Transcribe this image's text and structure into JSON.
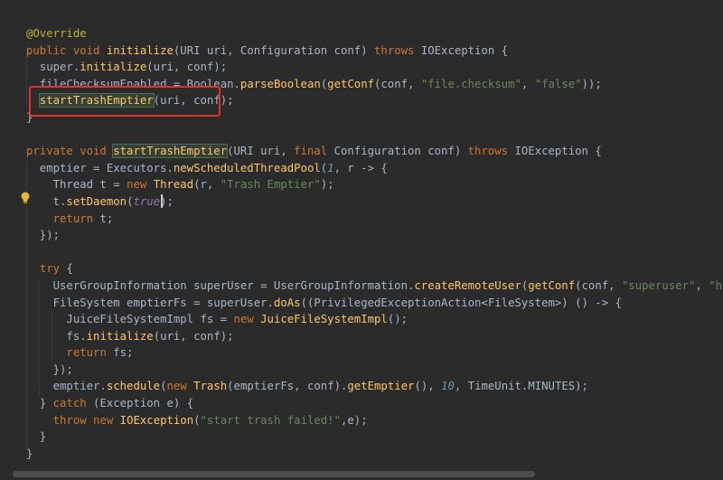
{
  "editor": {
    "lines": [
      [
        {
          "t": "@Override",
          "c": "ann"
        }
      ],
      [
        {
          "t": "public void ",
          "c": "kw"
        },
        {
          "t": "initialize",
          "c": "fn"
        },
        {
          "t": "(URI uri, Configuration conf) ",
          "c": "pl"
        },
        {
          "t": "throws ",
          "c": "kw"
        },
        {
          "t": "IOException {",
          "c": "pl"
        }
      ],
      [
        {
          "t": "  super.",
          "c": "pl"
        },
        {
          "t": "initialize",
          "c": "fn"
        },
        {
          "t": "(uri, conf);",
          "c": "pl"
        }
      ],
      [
        {
          "t": "  fileChecksumEnabled = Boolean.",
          "c": "pl"
        },
        {
          "t": "parseBoolean",
          "c": "fn"
        },
        {
          "t": "(",
          "c": "pl"
        },
        {
          "t": "getConf",
          "c": "fn"
        },
        {
          "t": "(conf, ",
          "c": "pl"
        },
        {
          "t": "\"file.checksum\"",
          "c": "str"
        },
        {
          "t": ", ",
          "c": "pl"
        },
        {
          "t": "\"false\"",
          "c": "str"
        },
        {
          "t": "));",
          "c": "pl"
        }
      ],
      [
        {
          "t": "  ",
          "c": "pl"
        },
        {
          "t": "startTrashEmptier",
          "c": "fn",
          "hl": true
        },
        {
          "t": "(uri, conf);",
          "c": "pl"
        }
      ],
      [
        {
          "t": "}",
          "c": "pl"
        }
      ],
      [],
      [
        {
          "t": "private void ",
          "c": "kw"
        },
        {
          "t": "startTrashEmptier",
          "c": "fn",
          "hl": true
        },
        {
          "t": "(URI uri, ",
          "c": "pl"
        },
        {
          "t": "final ",
          "c": "kw"
        },
        {
          "t": "Configuration conf) ",
          "c": "pl"
        },
        {
          "t": "throws ",
          "c": "kw"
        },
        {
          "t": "IOException {",
          "c": "pl"
        }
      ],
      [
        {
          "t": "  emptier = Executors.",
          "c": "pl"
        },
        {
          "t": "newScheduledThreadPool",
          "c": "fn"
        },
        {
          "t": "(",
          "c": "pl"
        },
        {
          "t": "1",
          "c": "num"
        },
        {
          "t": ", r -> {",
          "c": "pl"
        }
      ],
      [
        {
          "t": "    Thread t = ",
          "c": "pl"
        },
        {
          "t": "new ",
          "c": "kw"
        },
        {
          "t": "Thread",
          "c": "fn"
        },
        {
          "t": "(r, ",
          "c": "pl"
        },
        {
          "t": "\"Trash Emptier\"",
          "c": "str"
        },
        {
          "t": ");",
          "c": "pl"
        }
      ],
      [
        {
          "t": "    t.",
          "c": "pl"
        },
        {
          "t": "setDaemon",
          "c": "fn"
        },
        {
          "t": "(",
          "c": "pl"
        },
        {
          "t": "true",
          "c": "lit"
        },
        {
          "t": ");",
          "c": "pl"
        }
      ],
      [
        {
          "t": "    ",
          "c": "pl"
        },
        {
          "t": "return ",
          "c": "kw"
        },
        {
          "t": "t;",
          "c": "pl"
        }
      ],
      [
        {
          "t": "  });",
          "c": "pl"
        }
      ],
      [],
      [
        {
          "t": "  ",
          "c": "pl"
        },
        {
          "t": "try ",
          "c": "kw"
        },
        {
          "t": "{",
          "c": "pl"
        }
      ],
      [
        {
          "t": "    UserGroupInformation superUser = UserGroupInformation.",
          "c": "pl"
        },
        {
          "t": "createRemoteUser",
          "c": "fn"
        },
        {
          "t": "(",
          "c": "pl"
        },
        {
          "t": "getConf",
          "c": "fn"
        },
        {
          "t": "(conf, ",
          "c": "pl"
        },
        {
          "t": "\"superuser\"",
          "c": "str"
        },
        {
          "t": ", ",
          "c": "pl"
        },
        {
          "t": "\"hdfs\"",
          "c": "str"
        },
        {
          "t": "));",
          "c": "pl"
        }
      ],
      [
        {
          "t": "    FileSystem emptierFs = superUser.",
          "c": "pl"
        },
        {
          "t": "doAs",
          "c": "fn"
        },
        {
          "t": "((PrivilegedExceptionAction<FileSystem>) () -> {",
          "c": "pl"
        }
      ],
      [
        {
          "t": "      JuiceFileSystemImpl fs = ",
          "c": "pl"
        },
        {
          "t": "new ",
          "c": "kw"
        },
        {
          "t": "JuiceFileSystemImpl",
          "c": "fn"
        },
        {
          "t": "();",
          "c": "pl"
        }
      ],
      [
        {
          "t": "      fs.",
          "c": "pl"
        },
        {
          "t": "initialize",
          "c": "fn"
        },
        {
          "t": "(uri, conf);",
          "c": "pl"
        }
      ],
      [
        {
          "t": "      ",
          "c": "pl"
        },
        {
          "t": "return ",
          "c": "kw"
        },
        {
          "t": "fs;",
          "c": "pl"
        }
      ],
      [
        {
          "t": "    });",
          "c": "pl"
        }
      ],
      [
        {
          "t": "    emptier.",
          "c": "pl"
        },
        {
          "t": "schedule",
          "c": "fn"
        },
        {
          "t": "(",
          "c": "pl"
        },
        {
          "t": "new ",
          "c": "kw"
        },
        {
          "t": "Trash",
          "c": "fn"
        },
        {
          "t": "(emptierFs, conf).",
          "c": "pl"
        },
        {
          "t": "getEmptier",
          "c": "fn"
        },
        {
          "t": "(), ",
          "c": "pl"
        },
        {
          "t": "10",
          "c": "num"
        },
        {
          "t": ", TimeUnit.MINUTES);",
          "c": "pl"
        }
      ],
      [
        {
          "t": "  } ",
          "c": "pl"
        },
        {
          "t": "catch ",
          "c": "kw"
        },
        {
          "t": "(Exception e) {",
          "c": "pl"
        }
      ],
      [
        {
          "t": "    ",
          "c": "pl"
        },
        {
          "t": "throw new ",
          "c": "kw"
        },
        {
          "t": "IOException",
          "c": "fn"
        },
        {
          "t": "(",
          "c": "pl"
        },
        {
          "t": "\"start trash failed!\"",
          "c": "str"
        },
        {
          "t": ",e);",
          "c": "pl"
        }
      ],
      [
        {
          "t": "  }",
          "c": "pl"
        }
      ],
      [
        {
          "t": "}",
          "c": "pl"
        }
      ]
    ]
  }
}
